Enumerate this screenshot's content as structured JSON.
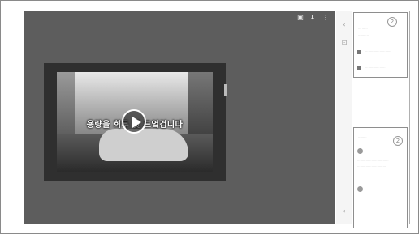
{
  "viewer": {
    "toolbar": {
      "icons": [
        "comment-icon",
        "download-icon",
        "more-vertical-icon"
      ],
      "glyphs": [
        "▣",
        "⬇",
        "⋮"
      ]
    },
    "video": {
      "subtitle": "용량을 희두 잇 드엌겁니다",
      "play_icon": "play-icon"
    }
  },
  "rail": {
    "glyphs": [
      "‹",
      "⊡",
      "‹"
    ],
    "icons": [
      "rail-collapse-icon",
      "rail-note-icon",
      "rail-history-icon"
    ]
  },
  "panel": {
    "card1": {
      "number": "2",
      "line1": "⋯ ⋯",
      "line2": "⋯ ⋯⋯",
      "line3": "⋯⋯⋯⋯",
      "row1": "⋯⋯⋯⋯⋯⋯⋯⋯⋯",
      "row2": "⋯⋯⋯⋯⋯⋯⋯"
    },
    "misc1": "⋯",
    "misc2": "⋯ ⋯",
    "card2": {
      "number": "2",
      "header": "⋯⋯⋯",
      "user1": "⋯⋯⋯⋯",
      "body1": "⋯⋯⋯⋯⋯⋯⋯⋯⋯⋯⋯",
      "body2": "⋯⋯⋯⋯⋯⋯⋯⋯⋯⋯",
      "user2": "⋯⋯⋯⋯⋯"
    },
    "bottom": "⋯"
  }
}
